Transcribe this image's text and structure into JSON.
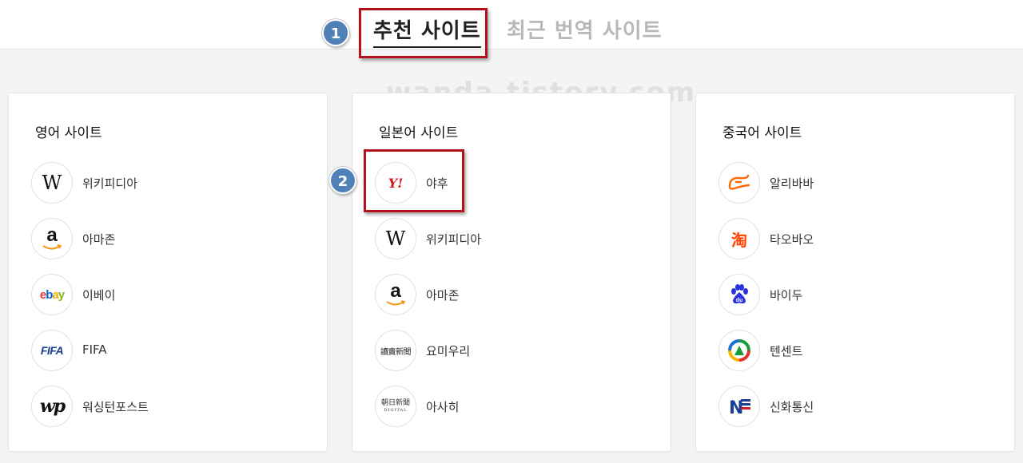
{
  "tabs": {
    "recommended": "추천 사이트",
    "recent": "최근 번역 사이트"
  },
  "annotations": {
    "step1": "1",
    "step2": "2"
  },
  "watermark": "wanda.tistory.com",
  "cards": [
    {
      "title": "영어 사이트",
      "sites": [
        {
          "label": "위키피디아",
          "icon": "wikipedia-icon",
          "logo_text": "W"
        },
        {
          "label": "아마존",
          "icon": "amazon-icon",
          "logo_text": "a"
        },
        {
          "label": "이베이",
          "icon": "ebay-icon",
          "logo_text": "ebay"
        },
        {
          "label": "FIFA",
          "icon": "fifa-icon",
          "logo_text": "FIFA"
        },
        {
          "label": "워싱턴포스트",
          "icon": "washington-post-icon",
          "logo_text": "wp"
        }
      ]
    },
    {
      "title": "일본어 사이트",
      "sites": [
        {
          "label": "야후",
          "icon": "yahoo-icon",
          "logo_text": "Y!"
        },
        {
          "label": "위키피디아",
          "icon": "wikipedia-icon",
          "logo_text": "W"
        },
        {
          "label": "아마존",
          "icon": "amazon-icon",
          "logo_text": "a"
        },
        {
          "label": "요미우리",
          "icon": "yomiuri-icon",
          "logo_text": "讀賣新聞"
        },
        {
          "label": "아사히",
          "icon": "asahi-icon",
          "logo_text": "朝日新聞",
          "logo_subtext": "DIGITAL"
        }
      ]
    },
    {
      "title": "중국어 사이트",
      "sites": [
        {
          "label": "알리바바",
          "icon": "alibaba-icon"
        },
        {
          "label": "타오바오",
          "icon": "taobao-icon",
          "logo_text": "淘"
        },
        {
          "label": "바이두",
          "icon": "baidu-icon",
          "logo_text": "du"
        },
        {
          "label": "텐센트",
          "icon": "tencent-icon"
        },
        {
          "label": "신화통신",
          "icon": "xinhua-icon",
          "logo_text": "N"
        }
      ]
    }
  ],
  "colors": {
    "highlight": "#b3121a",
    "step_badge": "#4f80b8",
    "tab_inactive": "#b8b8b8"
  }
}
